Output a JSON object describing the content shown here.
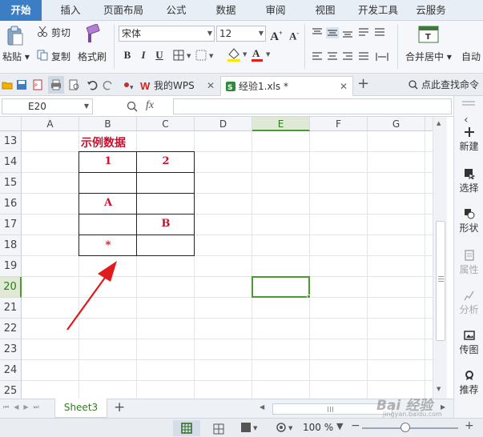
{
  "menu": {
    "tabs": [
      "开始",
      "插入",
      "页面布局",
      "公式",
      "数据",
      "审阅",
      "视图",
      "开发工具",
      "云服务"
    ],
    "active": "开始"
  },
  "ribbon": {
    "paste": "粘贴",
    "cut": "剪切",
    "copy": "复制",
    "format_painter": "格式刷",
    "font_name": "宋体",
    "font_size": "12",
    "bold": "B",
    "italic": "I",
    "underline": "U",
    "merge_center": "合并居中",
    "auto_wrap": "自动"
  },
  "docbar": {
    "tabs": [
      {
        "label": "我的WPS",
        "active": false
      },
      {
        "label": "经验1.xls *",
        "active": true
      }
    ],
    "search": "点此查找命令"
  },
  "formula_bar": {
    "name_box": "E20",
    "fx": "fx",
    "formula": ""
  },
  "grid": {
    "columns": [
      "A",
      "B",
      "C",
      "D",
      "E",
      "F",
      "G"
    ],
    "selected_column": "E",
    "rows": [
      "13",
      "14",
      "15",
      "16",
      "17",
      "18",
      "19",
      "20",
      "21",
      "22",
      "23",
      "24",
      "25"
    ],
    "selected_row": "20",
    "title_text": "示例数据",
    "cells": [
      {
        "ref": "B14",
        "value": "1"
      },
      {
        "ref": "C14",
        "value": "2"
      },
      {
        "ref": "B16",
        "value": "A"
      },
      {
        "ref": "C17",
        "value": "B"
      },
      {
        "ref": "B18",
        "value": "*"
      }
    ],
    "annotation_color": "#e01b1b"
  },
  "side_panel": {
    "items": [
      {
        "label": "新建",
        "enabled": true
      },
      {
        "label": "选择",
        "enabled": true
      },
      {
        "label": "形状",
        "enabled": true
      },
      {
        "label": "属性",
        "enabled": false
      },
      {
        "label": "分析",
        "enabled": false
      },
      {
        "label": "传图",
        "enabled": true
      },
      {
        "label": "推荐",
        "enabled": true
      }
    ]
  },
  "sheets": {
    "tabs": [
      "Sheet3"
    ],
    "add": "+"
  },
  "status": {
    "zoom": "100 %",
    "zoom_level": 1.0
  },
  "watermark": {
    "logo": "Bai 经验",
    "url": "jingyan.baidu.com"
  },
  "colors": {
    "accent": "#3c7ec6",
    "selection": "#4b9b2e",
    "data_red": "#c8102e"
  }
}
